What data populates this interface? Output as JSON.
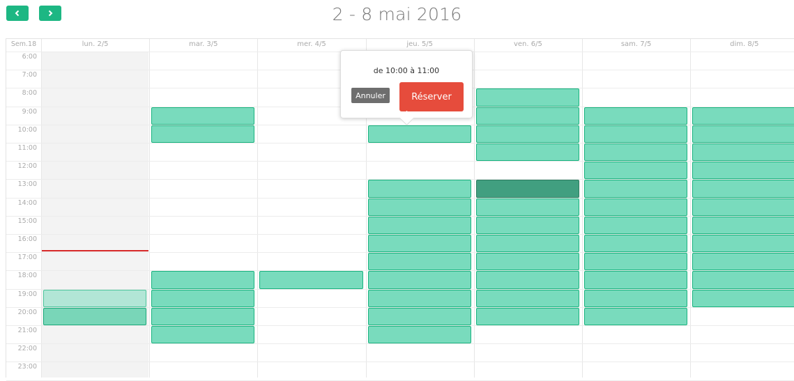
{
  "nav": {
    "prev_icon": "chevron-left-icon",
    "next_icon": "chevron-right-icon",
    "accent": "#1db783"
  },
  "title": "2 - 8 mai 2016",
  "week_label": "Sem.18",
  "days": [
    "lun. 2/5",
    "mar. 3/5",
    "mer. 4/5",
    "jeu. 5/5",
    "ven. 6/5",
    "sam. 7/5",
    "dim. 8/5"
  ],
  "hours": [
    "6:00",
    "7:00",
    "8:00",
    "9:00",
    "10:00",
    "11:00",
    "12:00",
    "13:00",
    "14:00",
    "15:00",
    "16:00",
    "17:00",
    "18:00",
    "19:00",
    "20:00",
    "21:00",
    "22:00",
    "23:00"
  ],
  "colors": {
    "slot": "#79dbbd",
    "slot_selected": "#419f80",
    "now_line": "#d62828",
    "book_button": "#e64c3c",
    "cancel_button": "#6e6e6e"
  },
  "popover": {
    "text": "de 10:00 à 11:00",
    "cancel_label": "Annuler",
    "book_label": "Réserver"
  }
}
